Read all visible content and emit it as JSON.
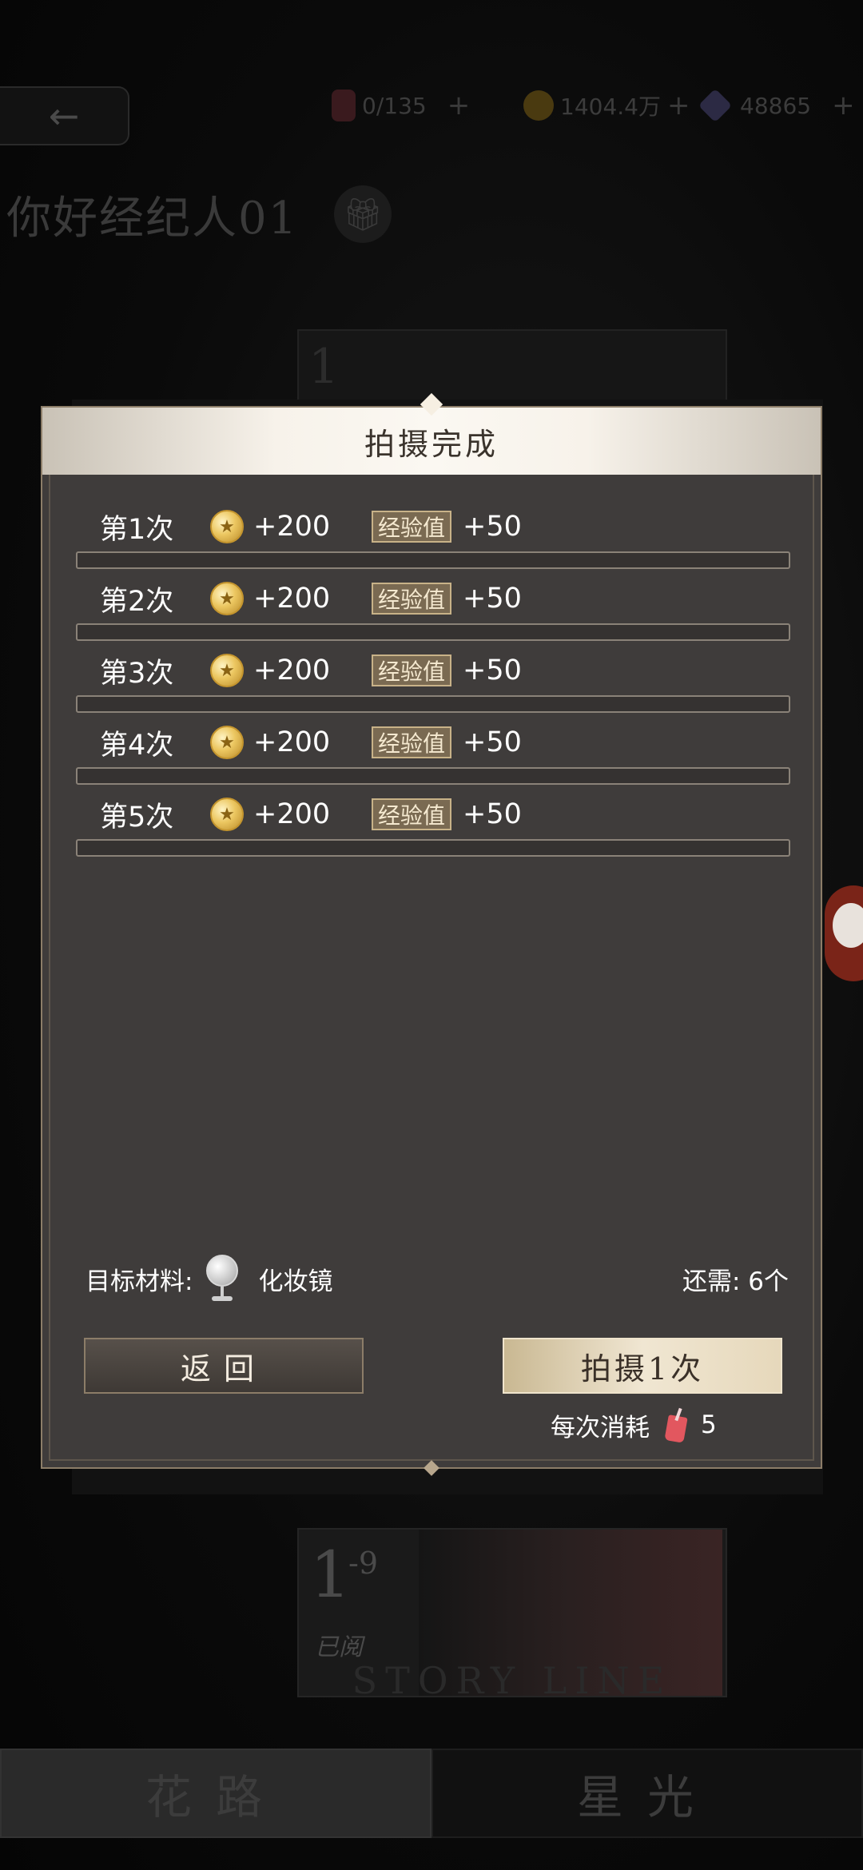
{
  "background": {
    "resources": [
      {
        "name": "drink",
        "value": "0/135"
      },
      {
        "name": "coin",
        "value": "1404.4万"
      },
      {
        "name": "gem",
        "value": "48865"
      }
    ],
    "greeting": "你好经纪人01",
    "top_card_number": "1",
    "bottom_card": {
      "number": "1",
      "sup": "-9",
      "status": "已阅",
      "watermark": "STORY LINE"
    },
    "tabs": [
      "花路",
      "星光"
    ]
  },
  "modal": {
    "title": "拍摄完成",
    "exp_label": "经验值",
    "rows": [
      {
        "label": "第1次",
        "coin": "+200",
        "exp": "+50"
      },
      {
        "label": "第2次",
        "coin": "+200",
        "exp": "+50"
      },
      {
        "label": "第3次",
        "coin": "+200",
        "exp": "+50"
      },
      {
        "label": "第4次",
        "coin": "+200",
        "exp": "+50"
      },
      {
        "label": "第5次",
        "coin": "+200",
        "exp": "+50"
      }
    ],
    "target_label": "目标材料:",
    "target_name": "化妆镜",
    "need_text": "还需: 6个",
    "back_button": "返回",
    "shoot_button": "拍摄1次",
    "cost_label": "每次消耗",
    "cost_value": "5"
  }
}
